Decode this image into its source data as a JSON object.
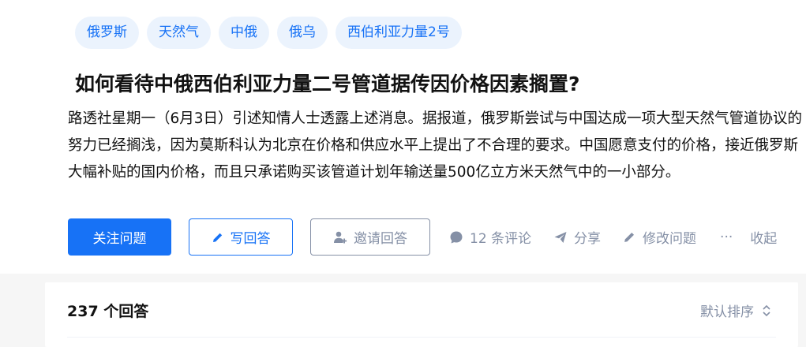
{
  "tags": [
    "俄罗斯",
    "天然气",
    "中俄",
    "俄乌",
    "西伯利亚力量2号"
  ],
  "question": {
    "title": "如何看待中俄西伯利亚力量二号管道据传因价格因素搁置?",
    "description": "路透社星期一（6月3日）引述知情人士透露上述消息。据报道，俄罗斯尝试与中国达成一项大型天然气管道协议的努力已经搁浅，因为莫斯科认为北京在价格和供应水平上提出了不合理的要求。中国愿意支付的价格，接近俄罗斯大幅补贴的国内价格，而且只承诺购买该管道计划年输送量500亿立方米天然气中的一小部分。"
  },
  "actions": {
    "follow": "关注问题",
    "write": "写回答",
    "invite": "邀请回答",
    "comments": "12 条评论",
    "share": "分享",
    "edit": "修改问题",
    "more": "···",
    "collapse": "收起"
  },
  "answers": {
    "count": "237 个回答",
    "sort": "默认排序"
  },
  "colors": {
    "accent": "#1772f6",
    "muted": "#8590a6"
  }
}
